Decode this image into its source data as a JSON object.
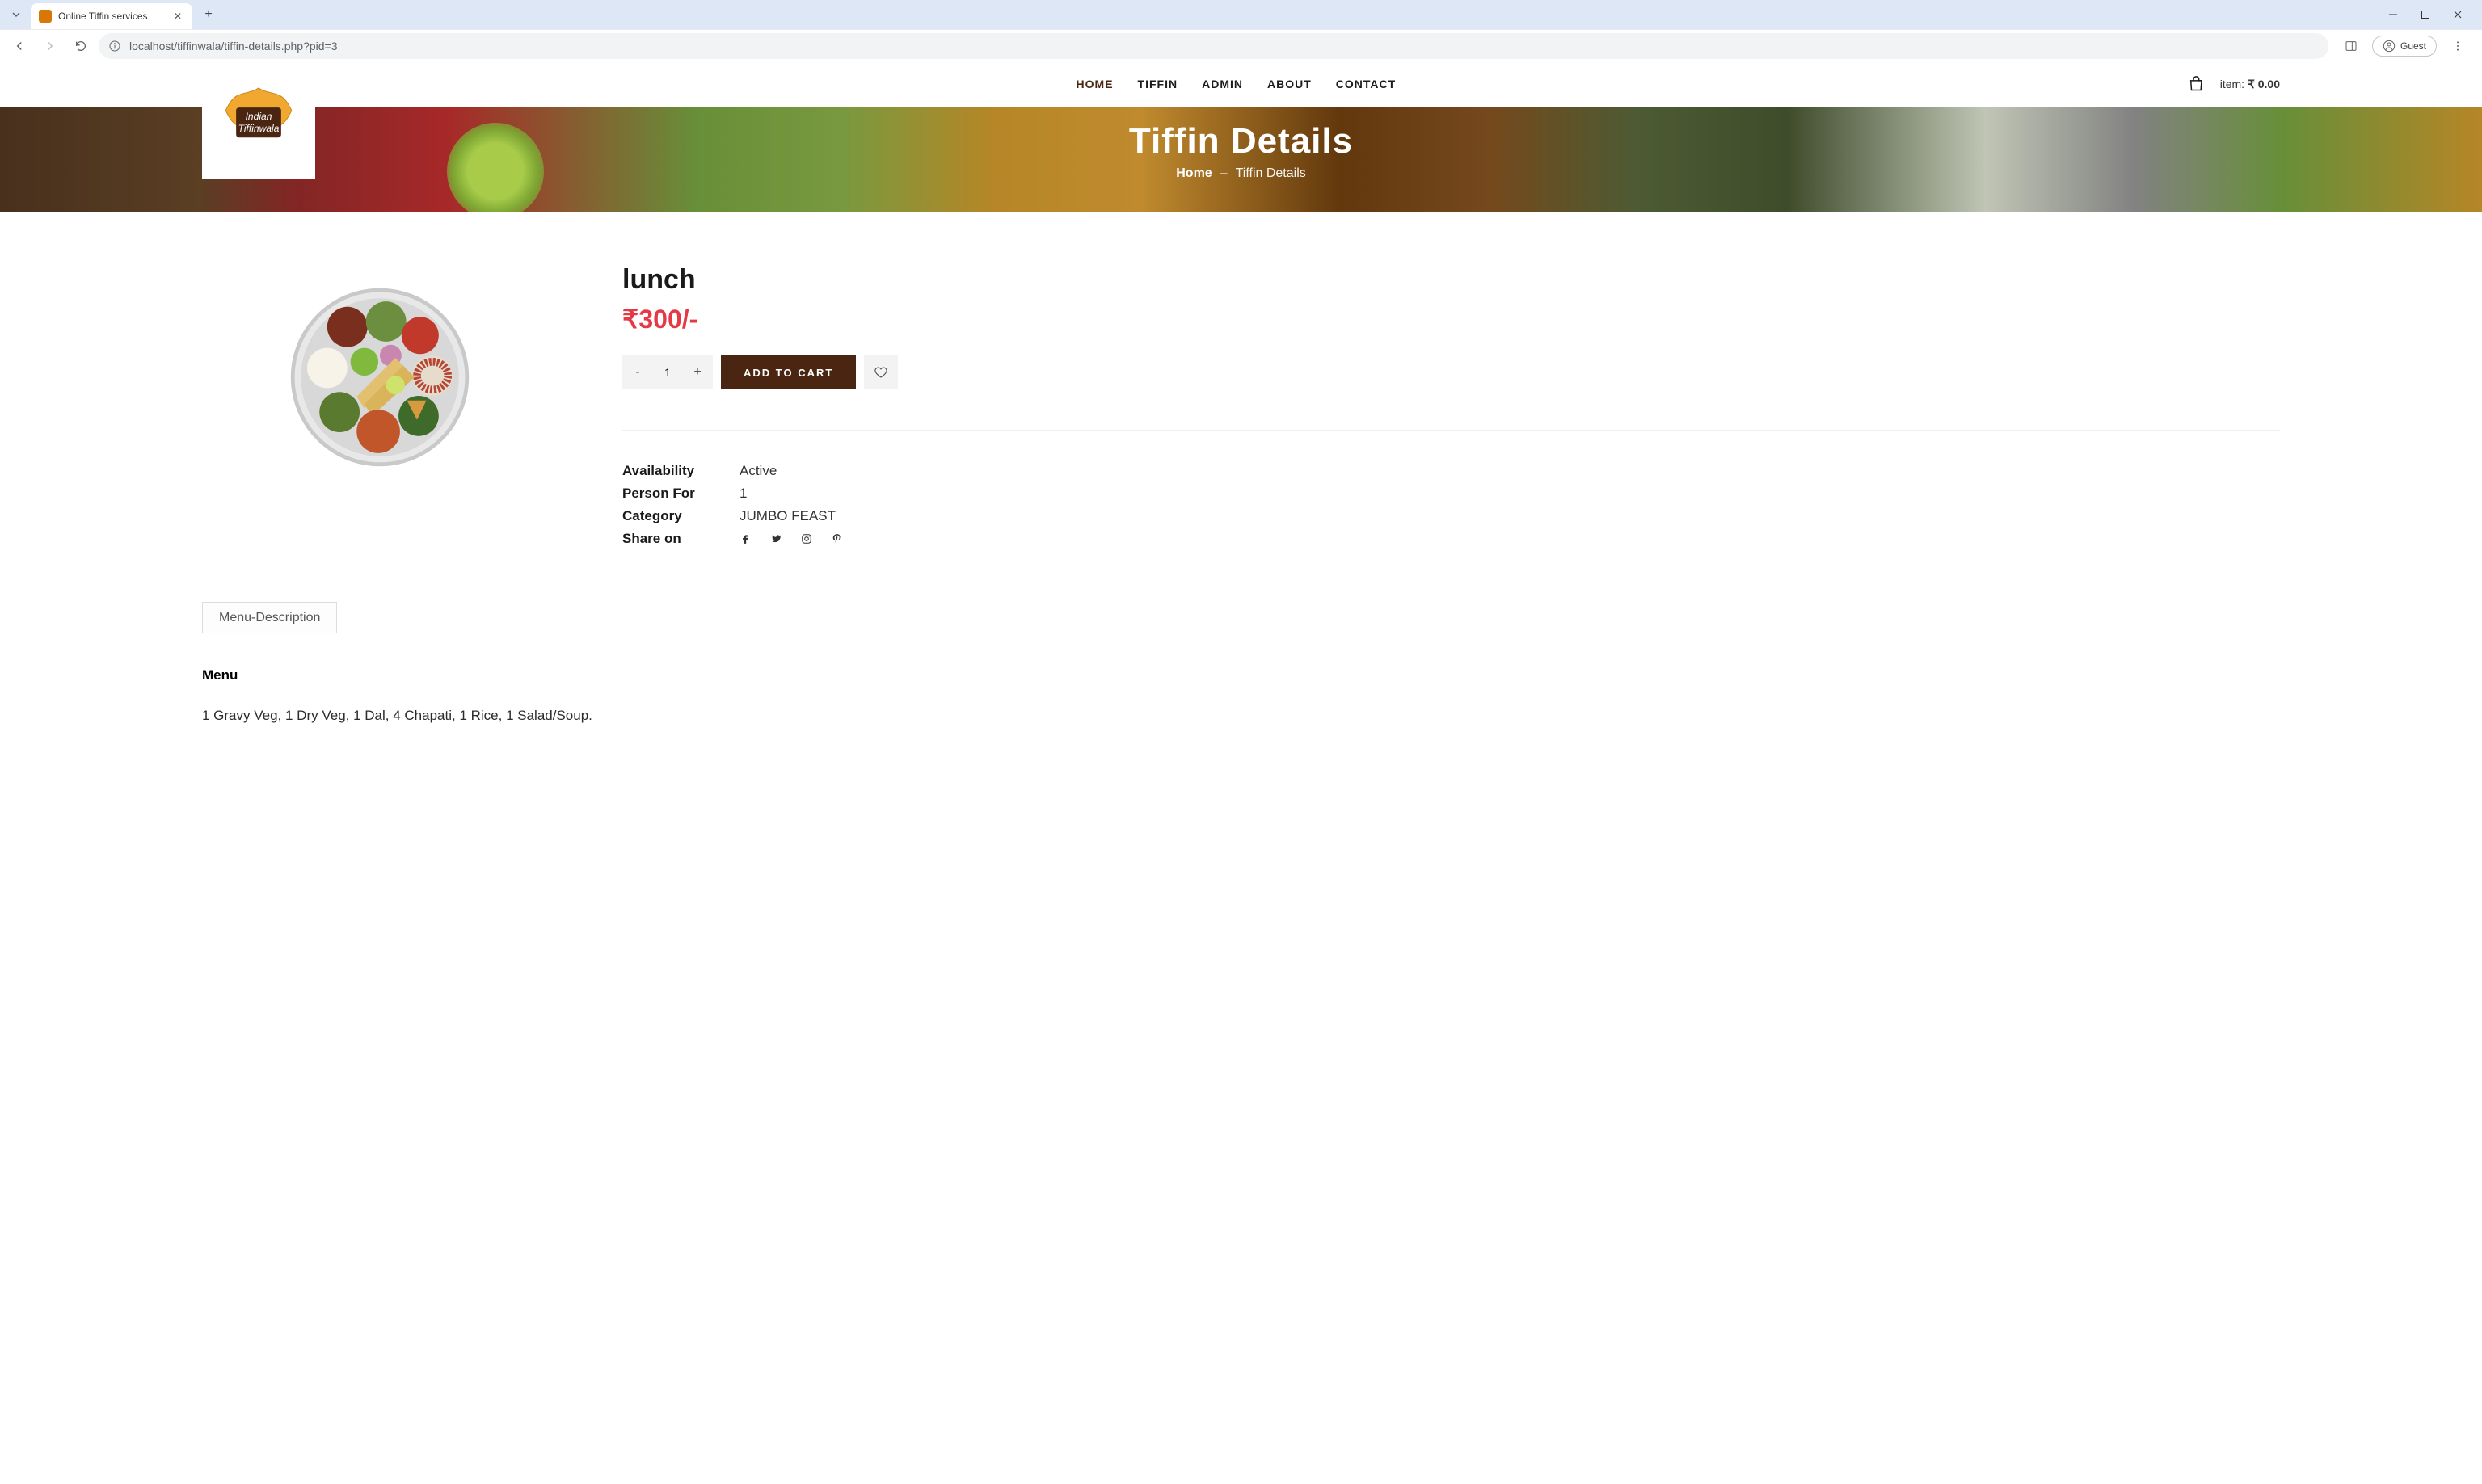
{
  "browser": {
    "tab_title": "Online Tiffin services",
    "url": "localhost/tiffinwala/tiffin-details.php?pid=3",
    "guest_label": "Guest"
  },
  "logo": {
    "line1": "Indian",
    "line2": "Tiffinwala"
  },
  "nav": {
    "items": [
      "HOME",
      "TIFFIN",
      "ADMIN",
      "ABOUT",
      "CONTACT"
    ]
  },
  "cart": {
    "label": "item:",
    "amount": "₹ 0.00"
  },
  "hero": {
    "title": "Tiffin Details",
    "breadcrumb_home": "Home",
    "breadcrumb_sep": "–",
    "breadcrumb_current": "Tiffin Details"
  },
  "product": {
    "name": "lunch",
    "price": "₹300/-",
    "quantity": "1",
    "add_to_cart": "ADD TO CART",
    "meta": {
      "availability_label": "Availability",
      "availability_value": "Active",
      "person_label": "Person For",
      "person_value": "1",
      "category_label": "Category",
      "category_value": "JUMBO FEAST",
      "share_label": "Share on"
    }
  },
  "tabs": {
    "description_tab": "Menu-Description",
    "menu_heading": "Menu",
    "menu_text": "1 Gravy Veg, 1 Dry Veg, 1 Dal, 4 Chapati, 1 Rice, 1 Salad/Soup."
  }
}
